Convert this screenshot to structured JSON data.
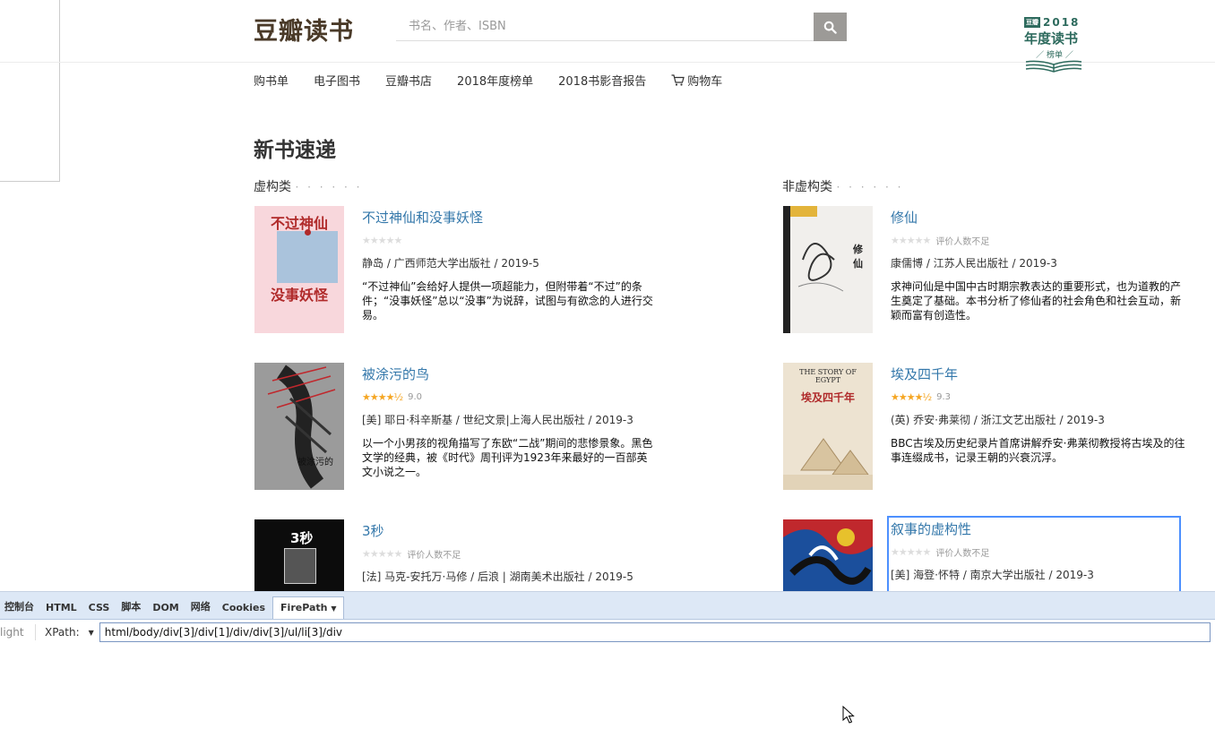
{
  "header": {
    "logo": "豆瓣读书",
    "search_placeholder": "书名、作者、ISBN",
    "badge": {
      "tag": "豆瓣",
      "year": "2018",
      "title": "年度读书",
      "sub": "／ 榜单 ／"
    }
  },
  "nav": {
    "items": [
      "购书单",
      "电子图书",
      "豆瓣书店",
      "2018年度榜单",
      "2018书影音报告"
    ],
    "cart_label": "购物车"
  },
  "section_title": "新书速递",
  "categories": {
    "fiction": "虚构类",
    "nonfiction": "非虚构类",
    "dots": "· · · · · ·"
  },
  "books": [
    {
      "title": "不过神仙和没事妖怪",
      "rating": "",
      "rating_text": "",
      "meta": "静岛 / 广西师范大学出版社 / 2019-5",
      "desc": "“不过神仙”会给好人提供一项超能力，但附带着“不过”的条件；“没事妖怪”总以“没事”为说辞，试图与有欲念的人进行交易。",
      "cover_text": "不过神仙\n没事妖怪"
    },
    {
      "title": "修仙",
      "rating": "",
      "rating_text": "评价人数不足",
      "meta": "康儒博 / 江苏人民出版社 / 2019-3",
      "desc": "求神问仙是中国中古时期宗教表达的重要形式，也为道教的产生奠定了基础。本书分析了修仙者的社会角色和社会互动，新颖而富有创造性。",
      "cover_text": "修仙"
    },
    {
      "title": "被涂污的鸟",
      "rating": "9.0",
      "rating_text": "",
      "meta": "[美] 耶日·科辛斯基 / 世纪文景|上海人民出版社 / 2019-3",
      "desc": "以一个小男孩的视角描写了东欧“二战”期间的悲惨景象。黑色文学的经典，被《时代》周刊评为1923年来最好的一百部英文小说之一。",
      "cover_text": "被涂污的鸟"
    },
    {
      "title": "埃及四千年",
      "rating": "9.3",
      "rating_text": "",
      "meta": "(英) 乔安·弗莱彻 / 浙江文艺出版社 / 2019-3",
      "desc": "BBC古埃及历史纪录片首席讲解乔安·弗莱彻教授将古埃及的往事连缀成书，记录王朝的兴衰沉浮。",
      "cover_text": "THE STORY OF EGYPT\n埃及四千年"
    },
    {
      "title": "3秒",
      "rating": "",
      "rating_text": "评价人数不足",
      "meta": "[法] 马克-安托万·马修 / 后浪 | 湖南美术出版社 / 2019-5",
      "desc": "",
      "cover_text": "3秒"
    },
    {
      "title": "叙事的虚构性",
      "rating": "",
      "rating_text": "评价人数不足",
      "meta": "[美] 海登·怀特 / 南京大学出版社 / 2019-3",
      "desc": "",
      "cover_text": ""
    }
  ],
  "devtools": {
    "tabs": [
      "控制台",
      "HTML",
      "CSS",
      "脚本",
      "DOM",
      "网络",
      "Cookies",
      "FirePath"
    ],
    "light_label": "light",
    "xpath_label": "XPath:",
    "xpath_value": "html/body/div[3]/div[1]/div/div[3]/ul/li[3]/div"
  },
  "colors": {
    "link": "#3377aa",
    "star": "#f5a623",
    "badge": "#2e6b5e",
    "highlight": "#4d90fe"
  }
}
